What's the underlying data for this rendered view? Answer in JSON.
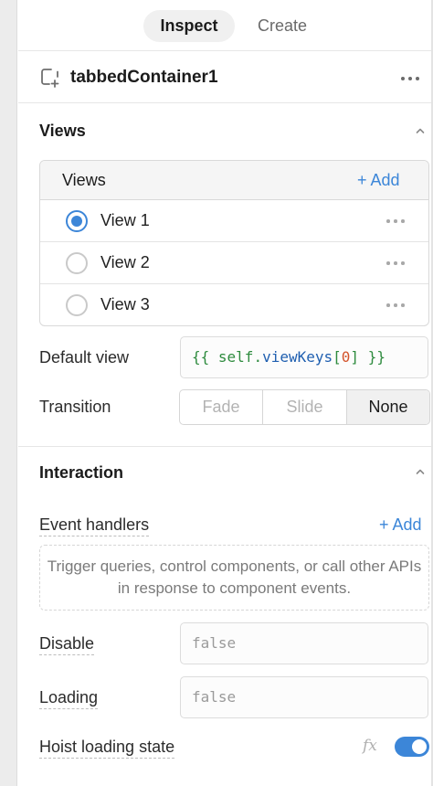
{
  "tabs": [
    {
      "label": "Inspect",
      "active": true
    },
    {
      "label": "Create",
      "active": false
    }
  ],
  "component": {
    "name": "tabbedContainer1",
    "icon": "container-plus-icon"
  },
  "views_section": {
    "title": "Views",
    "list_header": "Views",
    "add_label": "+ Add",
    "items": [
      {
        "label": "View 1",
        "selected": true
      },
      {
        "label": "View 2",
        "selected": false
      },
      {
        "label": "View 3",
        "selected": false
      }
    ],
    "default_view": {
      "label": "Default view",
      "value": "{{ self.viewKeys[0] }}",
      "tokens": {
        "open": "{{ ",
        "self": "self",
        "dot": ".",
        "key": "viewKeys",
        "lbr": "[",
        "num": "0",
        "rbr": "]",
        "close": " }}"
      }
    },
    "transition": {
      "label": "Transition",
      "options": [
        "Fade",
        "Slide",
        "None"
      ],
      "selected": "None"
    }
  },
  "interaction_section": {
    "title": "Interaction",
    "event_handlers": {
      "label": "Event handlers",
      "add_label": "+ Add",
      "empty_text": "Trigger queries, control components, or call other APIs in response to component events."
    },
    "disable": {
      "label": "Disable",
      "placeholder": "false"
    },
    "loading": {
      "label": "Loading",
      "placeholder": "false"
    },
    "hoist_loading_state": {
      "label": "Hoist loading state",
      "fx_label": "fx",
      "enabled": true
    }
  },
  "colors": {
    "accent": "#3c86d8",
    "code_green": "#2e8b3e",
    "code_blue": "#1f5fb0",
    "code_orange": "#d4542c"
  }
}
